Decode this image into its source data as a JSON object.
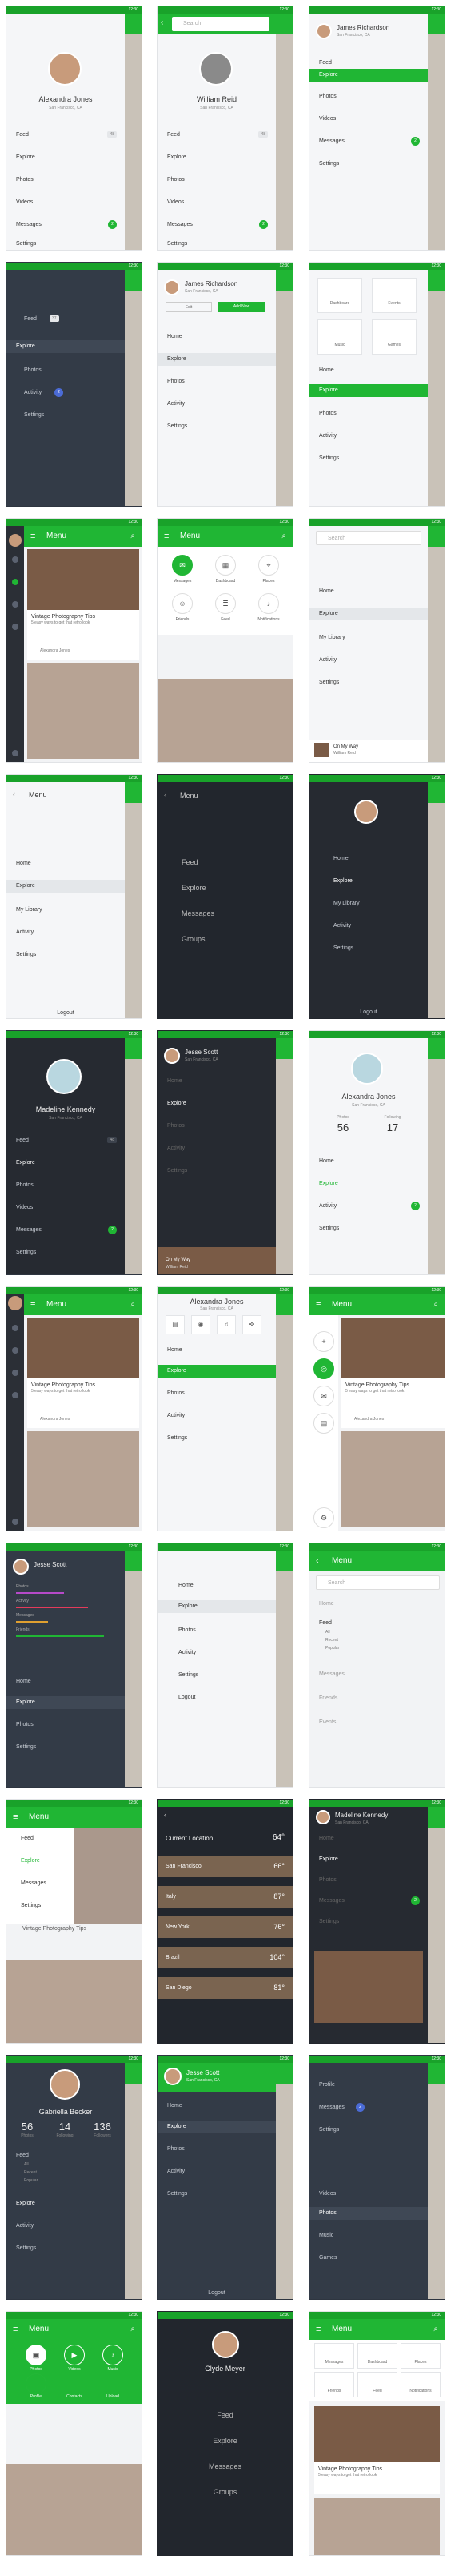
{
  "time": "12:30",
  "menu_title": "Menu",
  "search_placeholder": "Search",
  "users": {
    "alexandra": {
      "name": "Alexandra Jones",
      "location": "San Francisco, CA"
    },
    "william": {
      "name": "William Reid",
      "location": "San Francisco, CA"
    },
    "james": {
      "name": "James Richardson",
      "location": "San Francisco, CA"
    },
    "madeline": {
      "name": "Madeline Kennedy",
      "location": "San Francisco, CA"
    },
    "jesse": {
      "name": "Jesse Scott",
      "location": "San Francisco, CA"
    },
    "gabriella": {
      "name": "Gabriella Becker",
      "location": "San Francisco, CA"
    },
    "clyde": {
      "name": "Clyde Meyer"
    }
  },
  "menu": {
    "feed": "Feed",
    "explore": "Explore",
    "photos": "Photos",
    "videos": "Videos",
    "messages": "Messages",
    "settings": "Settings",
    "activity": "Activity",
    "home": "Home",
    "my_library": "My Library",
    "logout": "Logout",
    "groups": "Groups",
    "music": "Music",
    "games": "Games",
    "profile": "Profile",
    "dashboard": "Dashboard",
    "places": "Places",
    "friends": "Friends",
    "notifications": "Notifications",
    "events": "Events",
    "album": "Album",
    "contacts": "Contacts",
    "upload": "Upload",
    "camera": "Camera"
  },
  "counts": {
    "feed": "48",
    "feed2": "37",
    "messages": "2"
  },
  "buttons": {
    "edit": "Edit",
    "add_new": "Add New"
  },
  "post": {
    "title": "Vintage Photography Tips",
    "sub": "5 easy ways to get that retro look",
    "author": "Alexandra Jones"
  },
  "track": {
    "title": "On My Way",
    "artist": "William Reid"
  },
  "stats": {
    "photos_label": "Photos",
    "photos": "56",
    "following_label": "Following",
    "following": "17"
  },
  "stats2": {
    "photos": "56",
    "following": "14",
    "followers": "136",
    "photos_label": "Photos",
    "following_label": "Following",
    "followers_label": "Followers"
  },
  "weather": {
    "current_label": "Current Location",
    "current_temp": "64°",
    "rows": [
      {
        "city": "San Francisco",
        "temp": "66°"
      },
      {
        "city": "Italy",
        "temp": "87°"
      },
      {
        "city": "New York",
        "temp": "76°"
      },
      {
        "city": "Brazil",
        "temp": "104°"
      },
      {
        "city": "San Diego",
        "temp": "81°"
      }
    ]
  },
  "feed_sub": {
    "all": "All",
    "recent": "Recent",
    "popular": "Popular"
  },
  "tiles": {
    "t1": "Dashboard",
    "t2": "Events",
    "t3": "Music",
    "t4": "Games"
  }
}
